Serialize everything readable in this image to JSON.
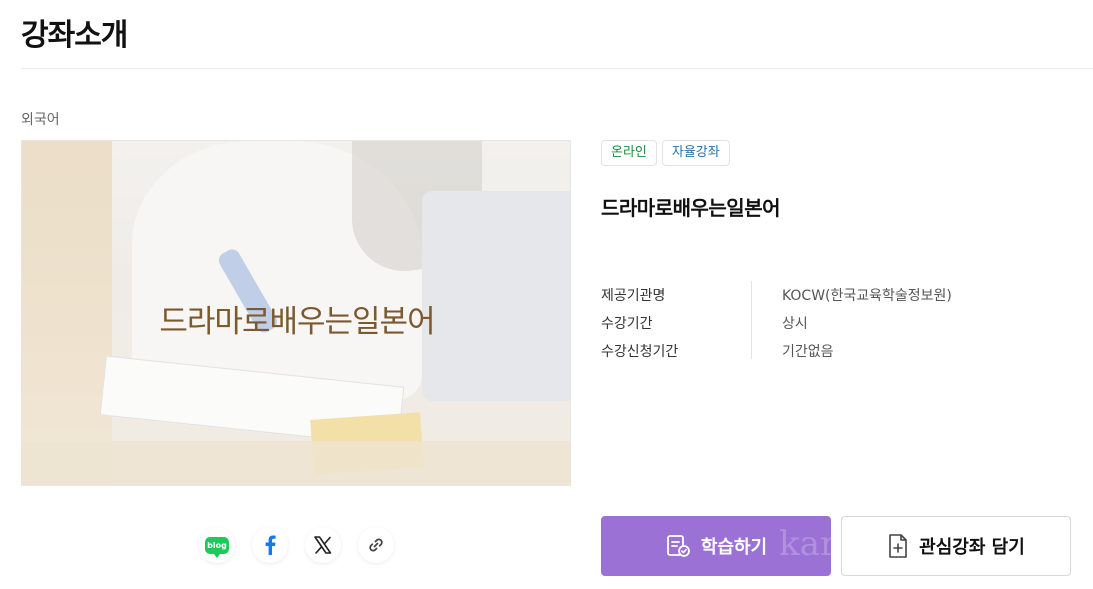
{
  "page": {
    "title": "강좌소개"
  },
  "course": {
    "category": "외국어",
    "thumbnail_text": "드라마로배우는일본어",
    "tags": [
      "온라인",
      "자율강좌"
    ],
    "title": "드라마로배우는일본어",
    "info": [
      {
        "label": "제공기관명",
        "value": "KOCW(한국교육학술정보원)"
      },
      {
        "label": "수강기간",
        "value": "상시"
      },
      {
        "label": "수강신청기간",
        "value": "기간없음"
      }
    ]
  },
  "share": {
    "blog_badge": "blog",
    "icons": [
      "naver-blog-icon",
      "facebook-icon",
      "x-icon",
      "link-icon"
    ]
  },
  "actions": {
    "learn_label": "학습하기",
    "learn_watermark": "kar",
    "wishlist_label": "관심강좌 담기"
  },
  "colors": {
    "primary_button": "#9b71d6",
    "tag_online": "#1a8a3f",
    "tag_self": "#2f6f9f",
    "thumbnail_text": "#7a5a2e"
  }
}
